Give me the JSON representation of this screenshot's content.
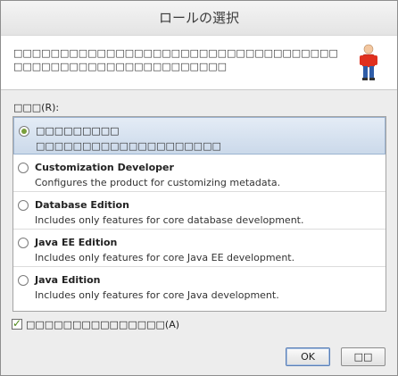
{
  "dialog": {
    "title": "ロールの選択",
    "header_text": "□□□□□□□□□□□□□□□□□□□□□□□□□□□□□□□□□□□□□□□□□□□□□□□□□□□□□□□□□□",
    "roles_label": "□□□(R):",
    "roles": [
      {
        "title": "□□□□□□□□□",
        "description": "□□□□□□□□□□□□□□□□□□□□",
        "selected": true
      },
      {
        "title": "Customization Developer",
        "description": "Configures the product for customizing metadata.",
        "selected": false
      },
      {
        "title": "Database Edition",
        "description": "Includes only features for core database development.",
        "selected": false
      },
      {
        "title": "Java EE Edition",
        "description": "Includes only features for core Java EE development.",
        "selected": false
      },
      {
        "title": "Java Edition",
        "description": "Includes only features for core Java development.",
        "selected": false
      }
    ],
    "checkbox_label": "□□□□□□□□□□□□□□□(A)",
    "checkbox_checked": true,
    "ok_label": "OK",
    "cancel_label": "□□",
    "colors": {
      "selection": "#cbd9ea",
      "radio_dot": "#7a9f3c",
      "check": "#4e8a1a"
    },
    "icons": [
      "person-icon",
      "check-icon"
    ]
  }
}
